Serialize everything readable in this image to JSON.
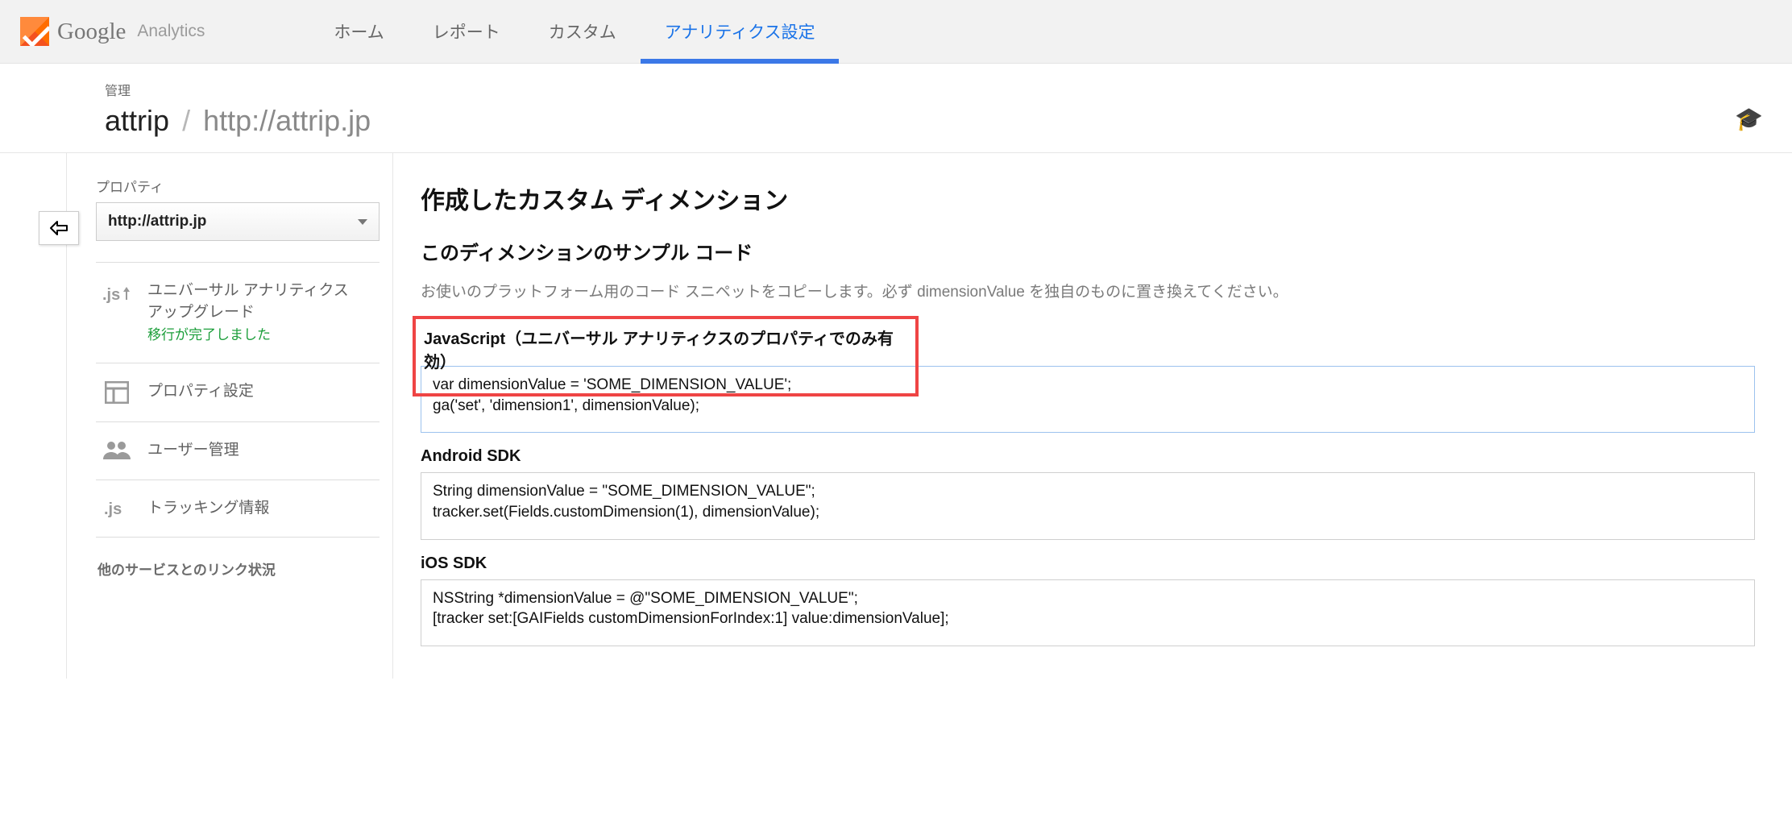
{
  "brand": {
    "main": "Google",
    "sub": "Analytics"
  },
  "topnav": {
    "home": "ホーム",
    "reports": "レポート",
    "custom": "カスタム",
    "admin": "アナリティクス設定"
  },
  "subhead": {
    "label": "管理",
    "account": "attrip",
    "property": "http://attrip.jp"
  },
  "sidebar": {
    "label": "プロパティ",
    "selected": "http://attrip.jp",
    "items": {
      "ua": {
        "title": "ユニバーサル アナリティクス\nアップグレード",
        "status": "移行が完了しました"
      },
      "settings": {
        "title": "プロパティ設定"
      },
      "users": {
        "title": "ユーザー管理"
      },
      "tracking": {
        "title": "トラッキング情報"
      }
    },
    "group_other": "他のサービスとのリンク状況"
  },
  "main": {
    "title": "作成したカスタム ディメンション",
    "sample_title": "このディメンションのサンプル コード",
    "lead": "お使いのプラットフォーム用のコード スニペットをコピーします。必ず dimensionValue を独自のものに置き換えてください。",
    "js_label": "JavaScript（ユニバーサル アナリティクスのプロパティでのみ有効）",
    "js_code": "var dimensionValue = 'SOME_DIMENSION_VALUE';\nga('set', 'dimension1', dimensionValue);",
    "android_label": "Android SDK",
    "android_code": "String dimensionValue = \"SOME_DIMENSION_VALUE\";\ntracker.set(Fields.customDimension(1), dimensionValue);",
    "ios_label": "iOS SDK",
    "ios_code": "NSString *dimensionValue = @\"SOME_DIMENSION_VALUE\";\n[tracker set:[GAIFields customDimensionForIndex:1] value:dimensionValue];"
  }
}
